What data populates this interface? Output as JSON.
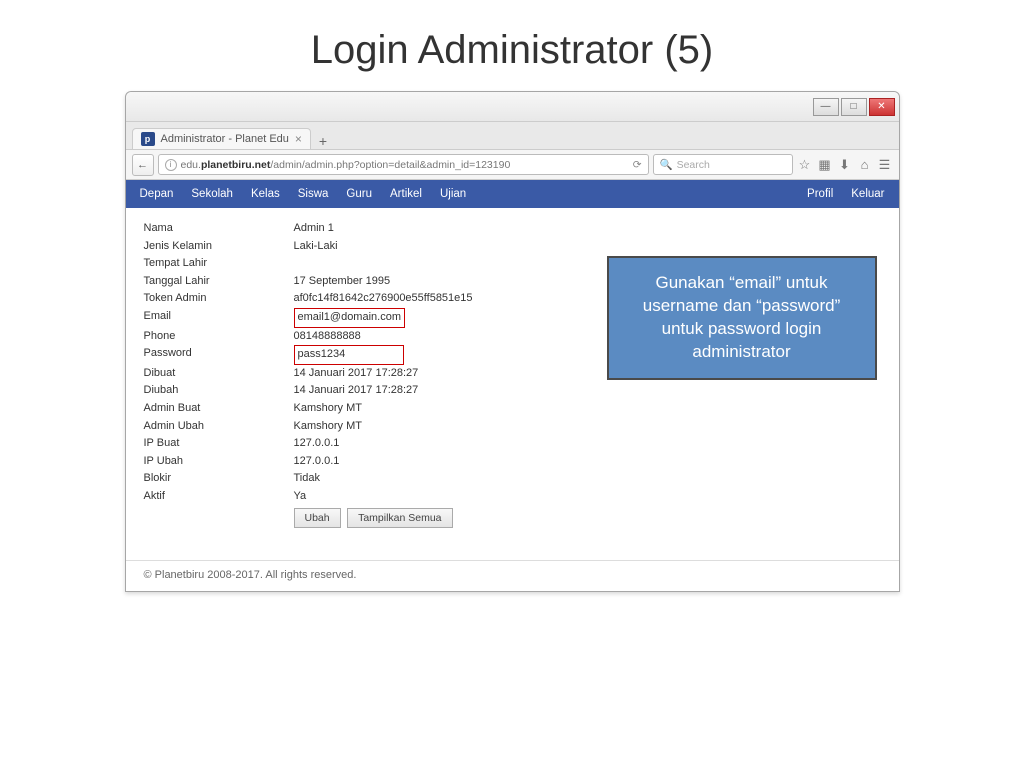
{
  "slide": {
    "title": "Login Administrator (5)"
  },
  "browser": {
    "tab_title": "Administrator - Planet Edu",
    "url_host": "planetbiru.net",
    "url_prefix": "edu.",
    "url_path": "/admin/admin.php?option=detail&admin_id=123190",
    "search_placeholder": "Search"
  },
  "nav": {
    "left": [
      "Depan",
      "Sekolah",
      "Kelas",
      "Siswa",
      "Guru",
      "Artikel",
      "Ujian"
    ],
    "right": [
      "Profil",
      "Keluar"
    ]
  },
  "details": [
    {
      "label": "Nama",
      "value": "Admin 1"
    },
    {
      "label": "Jenis Kelamin",
      "value": "Laki-Laki"
    },
    {
      "label": "Tempat Lahir",
      "value": ""
    },
    {
      "label": "Tanggal Lahir",
      "value": "17 September 1995"
    },
    {
      "label": "Token Admin",
      "value": "af0fc14f81642c276900e55ff5851e15"
    },
    {
      "label": "Email",
      "value": "email1@domain.com",
      "boxed": true
    },
    {
      "label": "Phone",
      "value": "08148888888"
    },
    {
      "label": "Password",
      "value": "pass1234",
      "boxed": true
    },
    {
      "label": "Dibuat",
      "value": "14 Januari 2017 17:28:27"
    },
    {
      "label": "Diubah",
      "value": "14 Januari 2017 17:28:27"
    },
    {
      "label": "Admin Buat",
      "value": "Kamshory MT"
    },
    {
      "label": "Admin Ubah",
      "value": "Kamshory MT"
    },
    {
      "label": "IP Buat",
      "value": "127.0.0.1"
    },
    {
      "label": "IP Ubah",
      "value": "127.0.0.1"
    },
    {
      "label": "Blokir",
      "value": "Tidak"
    },
    {
      "label": "Aktif",
      "value": "Ya"
    }
  ],
  "buttons": {
    "edit": "Ubah",
    "show_all": "Tampilkan Semua"
  },
  "footer": "© Planetbiru 2008-2017. All rights reserved.",
  "callout": "Gunakan “email” untuk username dan “password” untuk password login administrator"
}
